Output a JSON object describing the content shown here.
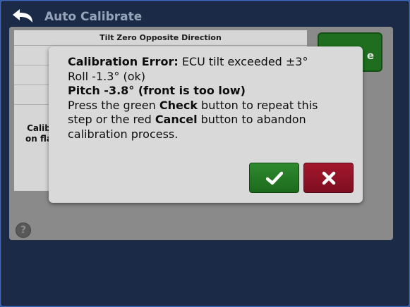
{
  "header": {
    "title": "Auto Calibrate",
    "back_icon": "back-arrow-icon"
  },
  "table": {
    "header": "Tilt Zero Opposite Direction",
    "row_label_line1": "Calib",
    "row_label_line2": "on fla"
  },
  "side_button": {
    "label": "e"
  },
  "help": {
    "icon": "help-icon",
    "glyph": "?"
  },
  "dialog": {
    "line1_bold": "Calibration Error:",
    "line1_rest": " ECU tilt exceeded ±3°",
    "line2": "Roll -1.3° (ok)",
    "line3_bold": "Pitch -3.8° (front is too low)",
    "line4_a": "Press the green ",
    "line4_bold": "Check",
    "line4_b": " button to repeat this",
    "line5_a": "step or the red ",
    "line5_bold": "Cancel",
    "line5_b": " button to abandon",
    "line6": "calibration process.",
    "confirm_icon": "check-icon",
    "cancel_icon": "close-icon"
  },
  "colors": {
    "confirm": "#2a7f2a",
    "cancel": "#9a1428",
    "background": "#1a2a47"
  }
}
